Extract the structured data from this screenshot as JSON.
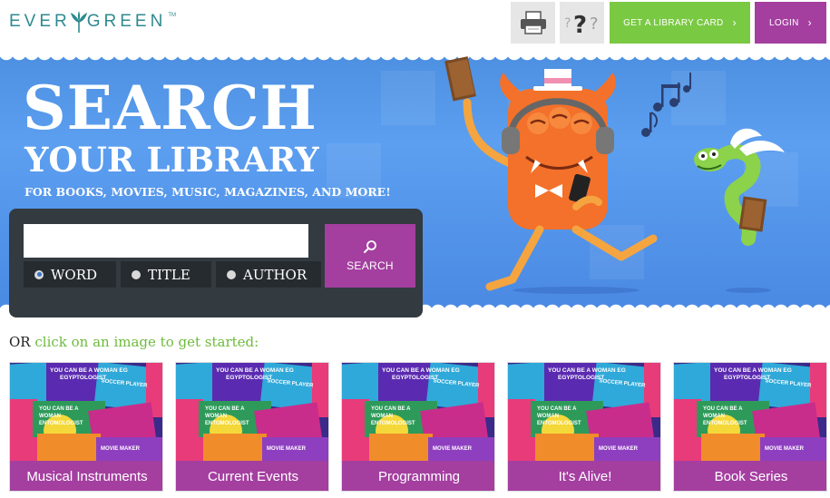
{
  "header": {
    "logo_text_left": "EVER",
    "logo_text_right": "GREEN",
    "logo_tm": "TM",
    "print_icon": "printer-icon",
    "help_icon": "question-marks-icon",
    "card_label": "GET A LIBRARY CARD",
    "login_label": "LOGIN"
  },
  "hero": {
    "title": "SEARCH",
    "subtitle": "YOUR LIBRARY",
    "tagline": "FOR BOOKS, MOVIES, MUSIC, MAGAZINES, AND MORE!"
  },
  "search": {
    "input_value": "",
    "input_placeholder": "",
    "button_label": "SEARCH",
    "options": [
      "WORD",
      "TITLE",
      "AUTHOR"
    ],
    "selected": "WORD"
  },
  "browse": {
    "prefix": "OR",
    "prompt": "click on an image to get started:",
    "cards": [
      {
        "label": "Musical Instruments"
      },
      {
        "label": "Current Events"
      },
      {
        "label": "Programming"
      },
      {
        "label": "It's Alive!"
      },
      {
        "label": "Book Series"
      }
    ],
    "book_cover_text": {
      "woman_egyptologist": "YOU CAN BE A WOMAN EGYPTOLOGIST",
      "soccer_player": "YOU CAN BE A WOMAN SOCCER PLAYER",
      "entomologist": "YOU CAN BE A WOMAN ENTOMOLOGIST",
      "movie_maker": "YOU CAN BE A WOMAN MOVIE MAKER"
    }
  },
  "colors": {
    "brand_teal": "#2d8a8f",
    "green": "#7ac943",
    "purple": "#a43fa0",
    "hero_blue": "#4d8fe0",
    "panel_dark": "#333a40"
  }
}
